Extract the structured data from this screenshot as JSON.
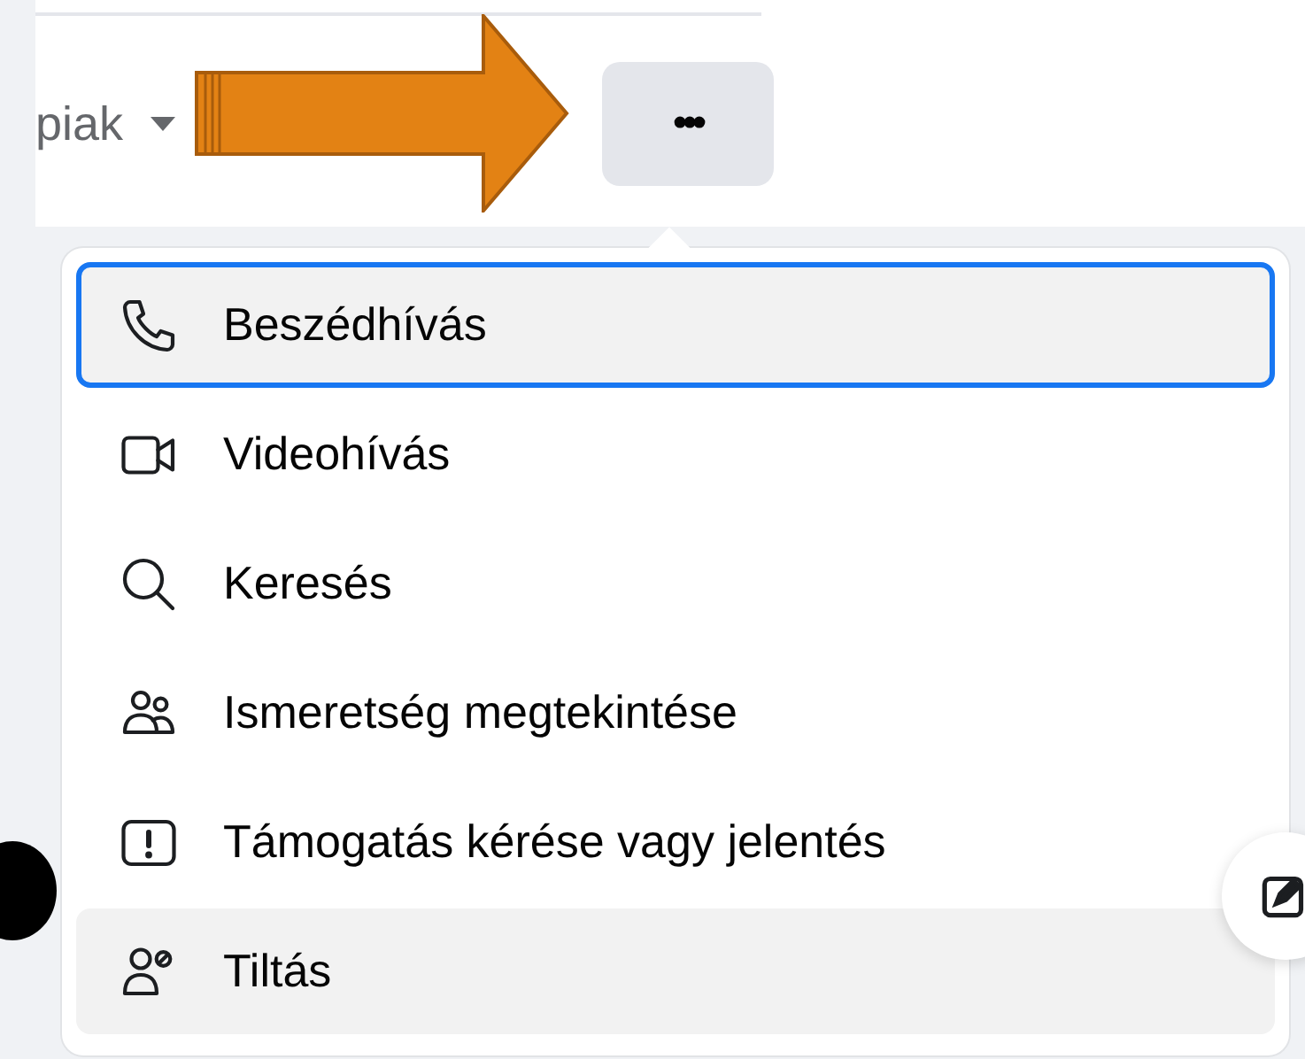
{
  "header": {
    "name_fragment": "piak",
    "more_button": "•••"
  },
  "menu": {
    "items": [
      {
        "kind": "phone",
        "label": "Beszédhívás",
        "focused": true,
        "highlighted": false
      },
      {
        "kind": "video",
        "label": "Videohívás",
        "focused": false,
        "highlighted": false
      },
      {
        "kind": "search",
        "label": "Keresés",
        "focused": false,
        "highlighted": false
      },
      {
        "kind": "people",
        "label": "Ismeretség megtekintése",
        "focused": false,
        "highlighted": false
      },
      {
        "kind": "report",
        "label": "Támogatás kérése vagy jelentés",
        "focused": false,
        "highlighted": false
      },
      {
        "kind": "block",
        "label": "Tiltás",
        "focused": false,
        "highlighted": true
      }
    ]
  }
}
